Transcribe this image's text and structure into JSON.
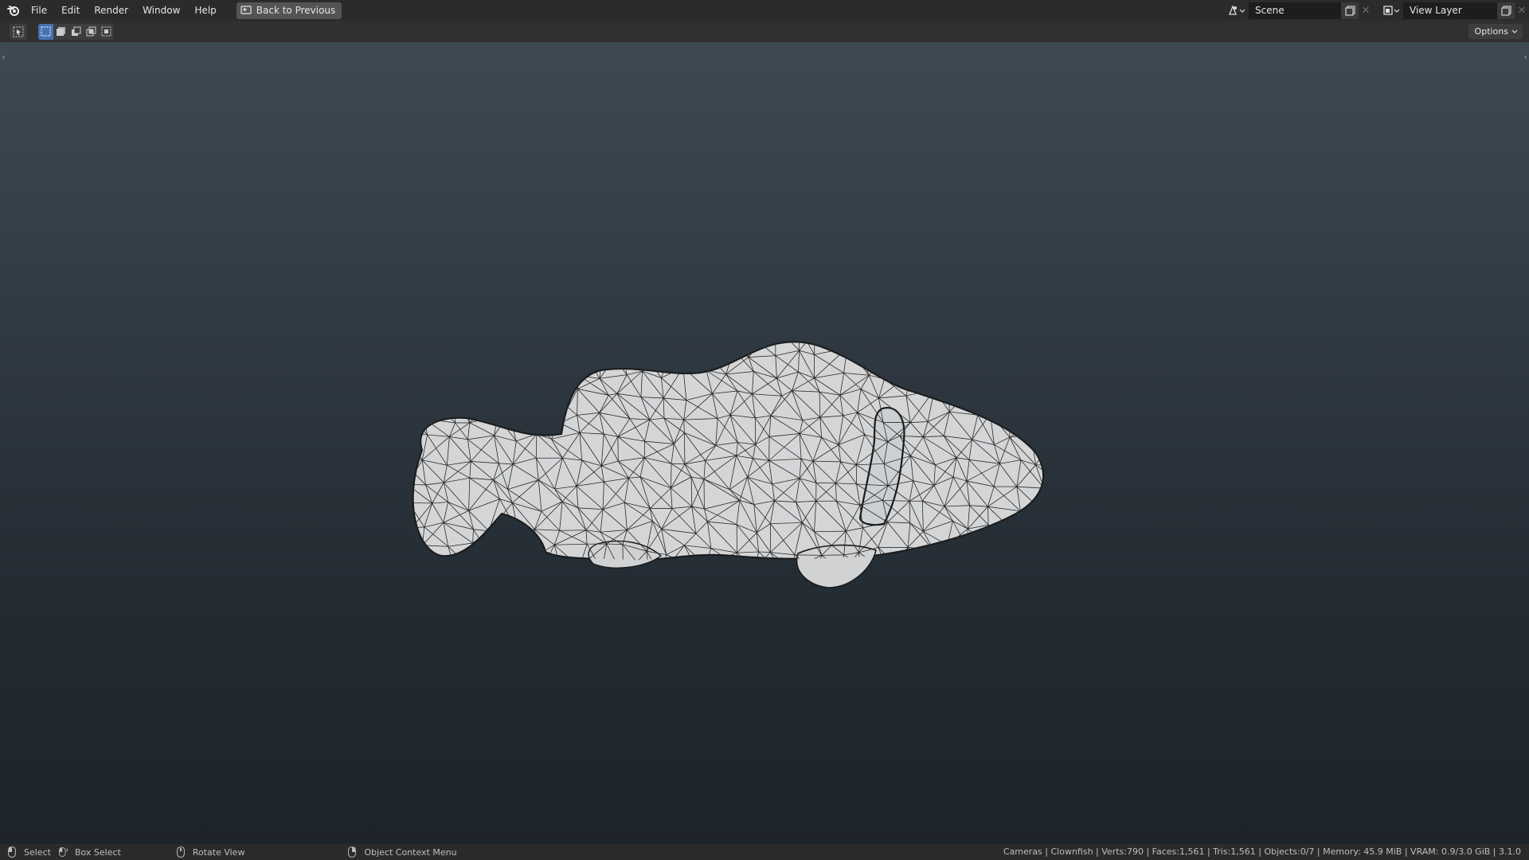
{
  "menu": {
    "items": [
      {
        "label": "File"
      },
      {
        "label": "Edit"
      },
      {
        "label": "Render"
      },
      {
        "label": "Window"
      },
      {
        "label": "Help"
      }
    ],
    "back_button": "Back to Previous"
  },
  "scene": {
    "value": "Scene",
    "icon": "scene-icon"
  },
  "view_layer": {
    "value": "View Layer",
    "icon": "view-layer-icon"
  },
  "header": {
    "options_label": "Options"
  },
  "viewport": {
    "object_name": "Clownfish",
    "colors": {
      "mesh_fill": "#d2d4d6",
      "wire": "#1a1a1a",
      "bg_top": "#3e4a52",
      "bg_bottom": "#1e242a"
    }
  },
  "statusbar": {
    "hints": [
      {
        "label": "Select",
        "icon": "mouse-left-icon"
      },
      {
        "label": "Box Select",
        "icon": "mouse-drag-icon"
      },
      {
        "label": "Rotate View",
        "icon": "mouse-middle-icon"
      },
      {
        "label": "Object Context Menu",
        "icon": "mouse-right-icon"
      }
    ],
    "stats": "Cameras | Clownfish | Verts:790 | Faces:1,561 | Tris:1,561 | Objects:0/7 | Memory: 45.9 MiB | VRAM: 0.9/3.0 GiB | 3.1.0"
  }
}
